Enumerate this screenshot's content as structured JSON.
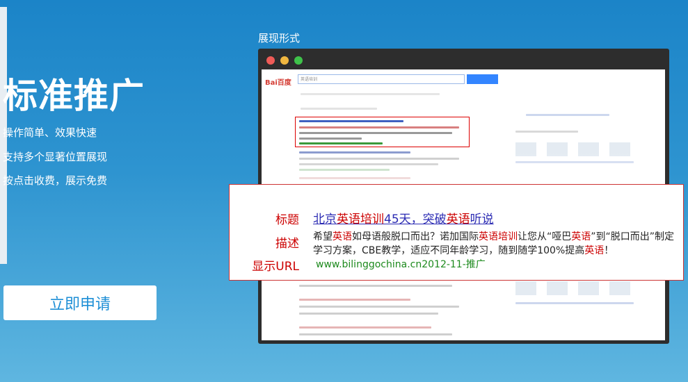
{
  "hero": {
    "title": "标准推广",
    "features": [
      "操作简单、效果快速",
      "支持多个显著位置展现",
      "按点击收费，展示免费"
    ],
    "apply_button": "立即申请"
  },
  "preview": {
    "section_label": "展现形式",
    "search_box_text": "英语培训",
    "popup": {
      "title_label": "标题",
      "desc_label": "描述",
      "url_label": "显示URL",
      "title_parts": [
        "北京",
        "英语培训",
        "45天，突破",
        "英语",
        "听说"
      ],
      "desc_parts": [
        "希望",
        "英语",
        "如母语般脱口而出？诺加国际",
        "英语培训",
        "让您从“哑巴",
        "英语",
        "”到“脱口而出”制定学习方案，CBE教学，适应不同年龄学习，随到随学100%提高",
        "英语",
        "！"
      ],
      "url": "www.bilinggochina.cn2012-11-推广"
    }
  },
  "colors": {
    "accent": "#1e8fd6",
    "highlight_red": "#cc0000",
    "url_green": "#1d8a1d",
    "title_blue": "#2b2bb3"
  }
}
